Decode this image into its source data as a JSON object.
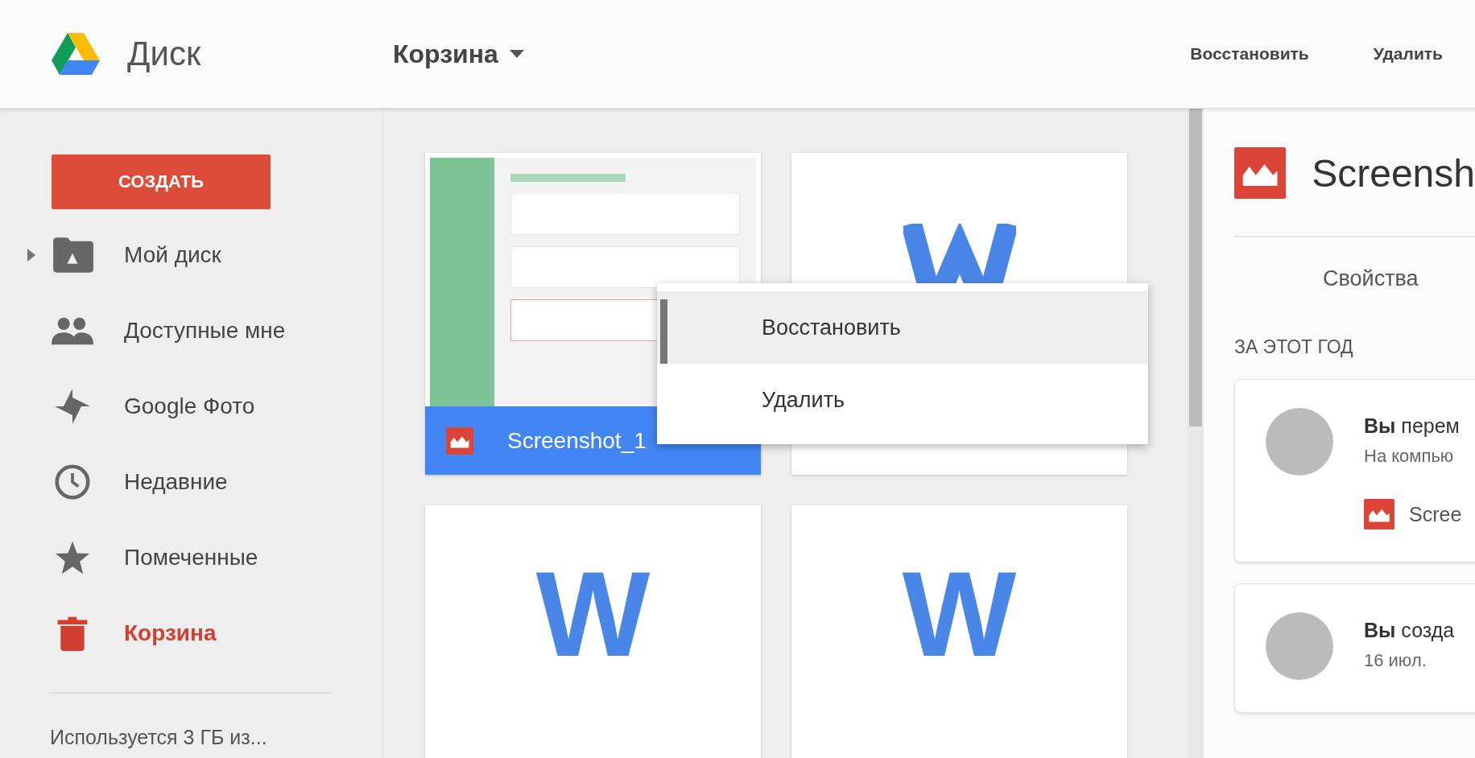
{
  "header": {
    "app_name": "Диск",
    "folder_title": "Корзина",
    "actions": [
      "Восстановить",
      "Удалить"
    ]
  },
  "sidebar": {
    "create_button": "СОЗДАТЬ",
    "items": [
      {
        "label": "Мой диск",
        "kind": "folder",
        "has_children": true,
        "selected": false
      },
      {
        "label": "Доступные мне",
        "kind": "people",
        "has_children": false,
        "selected": false
      },
      {
        "label": "Google Фото",
        "kind": "pinwheel",
        "has_children": false,
        "selected": false
      },
      {
        "label": "Недавние",
        "kind": "clock",
        "has_children": false,
        "selected": false
      },
      {
        "label": "Помеченные",
        "kind": "star",
        "has_children": false,
        "selected": false
      },
      {
        "label": "Корзина",
        "kind": "trash",
        "has_children": false,
        "selected": true
      }
    ],
    "storage": "Используется 3 ГБ из..."
  },
  "files": [
    {
      "kind": "image",
      "name": "Screenshot_1",
      "selected": true
    },
    {
      "kind": "word",
      "selected": false
    },
    {
      "kind": "word",
      "logo": "W",
      "selected": false
    },
    {
      "kind": "word",
      "logo": "W",
      "selected": false
    }
  ],
  "context_menu": {
    "items": [
      {
        "label": "Восстановить",
        "selected": true
      },
      {
        "label": "Удалить",
        "selected": false
      }
    ]
  },
  "details": {
    "title": "Screensh",
    "tab": "Свойства",
    "section": "ЗА ЭТОТ ГОД",
    "activities": [
      {
        "action": "**Вы** перем",
        "detail": "На компью",
        "file": "Scree"
      },
      {
        "action": "**Вы** созда",
        "detail": "16 июл."
      }
    ]
  }
}
